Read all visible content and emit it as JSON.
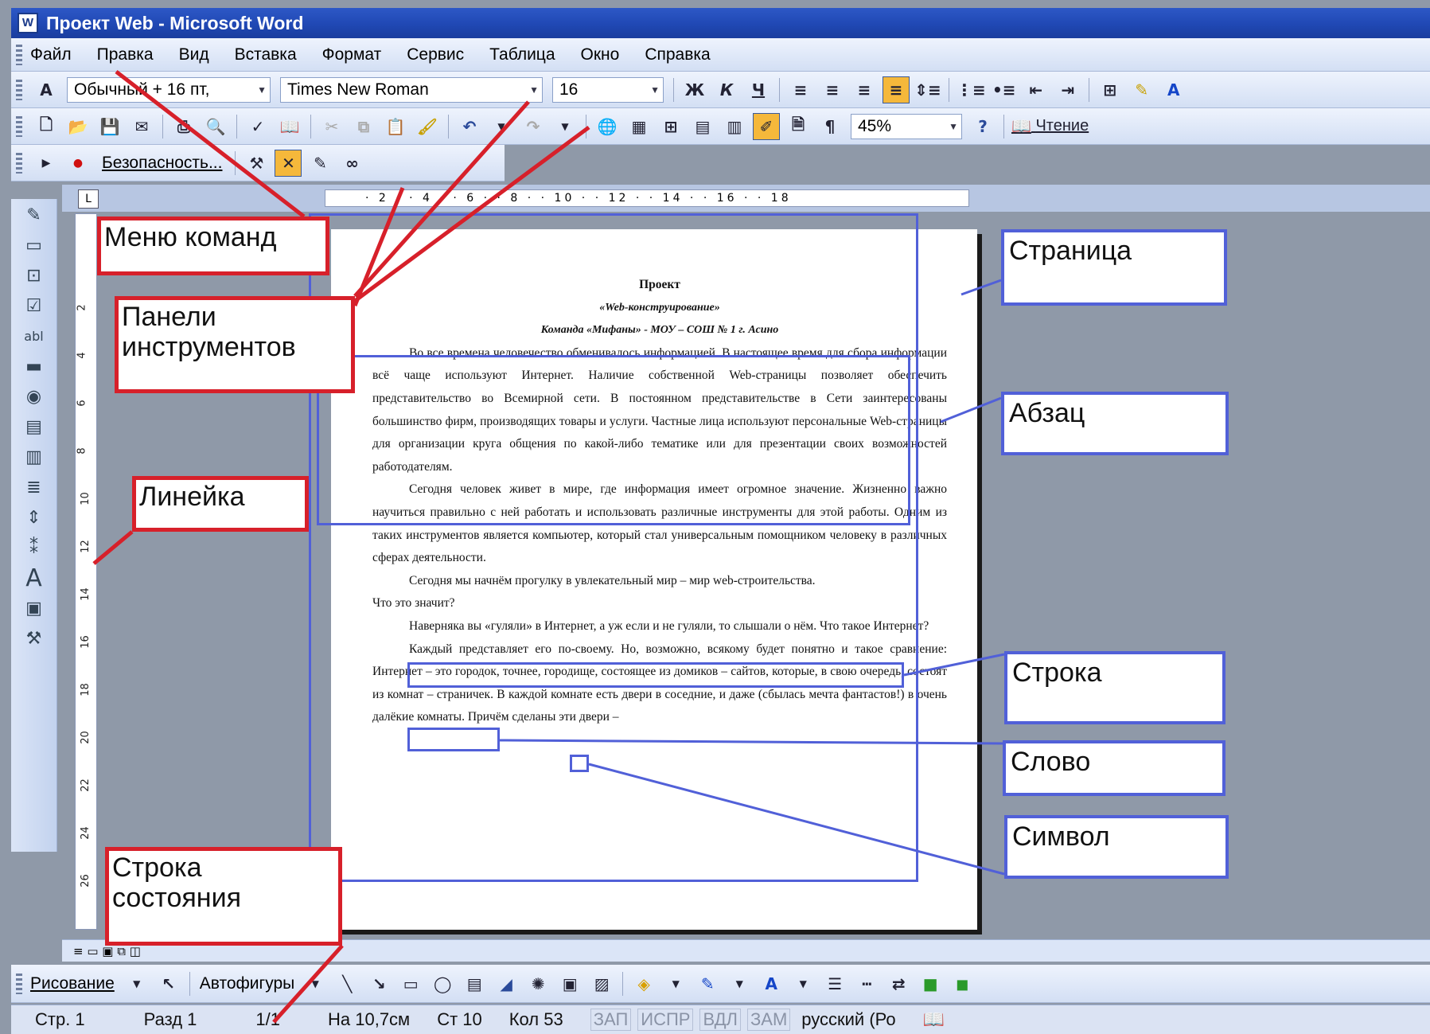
{
  "window": {
    "title": "Проект Web - Microsoft Word",
    "icon": "word-icon"
  },
  "menu": [
    "Файл",
    "Правка",
    "Вид",
    "Вставка",
    "Формат",
    "Сервис",
    "Таблица",
    "Окно",
    "Справка"
  ],
  "format_toolbar": {
    "style": "Обычный + 16 пт,",
    "font": "Times New Roman",
    "size": "16",
    "bold": "Ж",
    "italic": "К",
    "underline": "Ч"
  },
  "standard_toolbar": {
    "zoom": "45%",
    "read_label": "Чтение"
  },
  "security_toolbar": {
    "label": "Безопасность..."
  },
  "ruler": {
    "corner": "L",
    "marks": "· 2 · · 4 · · 6 · · 8 · · 10 · · 12 · · 14 · · 16 · · 18",
    "left_marks": [
      "2",
      "4",
      "6",
      "8",
      "10",
      "12",
      "14",
      "16",
      "18",
      "20",
      "22",
      "24",
      "26"
    ]
  },
  "document": {
    "title": "Проект",
    "subtitle": "«Web-конструирование»",
    "team": "Команда «Мифаны» - МОУ – СОШ № 1 г. Асино",
    "para1": "Во все времена человечество обменивалось информацией. В настоящее время для сбора информации всё чаще используют Интернет. Наличие собственной Web-страницы позволяет обеспечить представительство во Всемирной сети. В постоянном представительстве в Сети заинтересованы большинство фирм, производящих товары и услуги. Частные лица используют персональные Web-страницы для организации круга общения по какой-либо тематике или для презентации своих возможностей работодателям.",
    "para2": "Сегодня человек живет в мире, где информация имеет огромное значение. Жизненно важно научиться правильно с ней работать и использовать различные инструменты для этой работы. Одним из таких инструментов является компьютер, который стал универсальным помощником человеку в различных сферах деятельности.",
    "para3": "Сегодня мы начнём прогулку в увлекательный мир – мир web-строительства.",
    "para4": "Что это значит?",
    "para5": "Наверняка вы «гуляли» в Интернет, а уж если и не гуляли, то слышали о нём. Что такое Интернет?",
    "para6": "Каждый представляет его по-своему. Но, возможно, всякому будет понятно и такое сравнение: Интернет – это городок, точнее, городище, состоящее из домиков – сайтов, которые, в свою очередь, состоят из комнат – страничек. В каждой комнате есть двери в соседние, и даже (сбылась мечта фантастов!) в очень далёкие комнаты. Причём сделаны эти двери –"
  },
  "drawing_toolbar": {
    "draw": "Рисование",
    "autoshapes": "Автофигуры"
  },
  "status": {
    "page": "Стр. 1",
    "section": "Разд 1",
    "pages": "1/1",
    "at": "На 10,7см",
    "line": "Ст 10",
    "col": "Кол 53",
    "rec": "ЗАП",
    "trk": "ИСПР",
    "ext": "ВДЛ",
    "ovr": "ЗАМ",
    "lang": "русский (Ро"
  },
  "annotations": {
    "menu": "Меню команд",
    "toolbars_1": "Панели",
    "toolbars_2": "инструментов",
    "ruler": "Линейка",
    "statusbar_1": "Строка",
    "statusbar_2": "состояния",
    "page": "Страница",
    "paragraph": "Абзац",
    "line": "Строка",
    "word": "Слово",
    "symbol": "Символ"
  },
  "colors": {
    "red": "#d7202a",
    "blue": "#5160d8",
    "title": "#2048b4"
  }
}
